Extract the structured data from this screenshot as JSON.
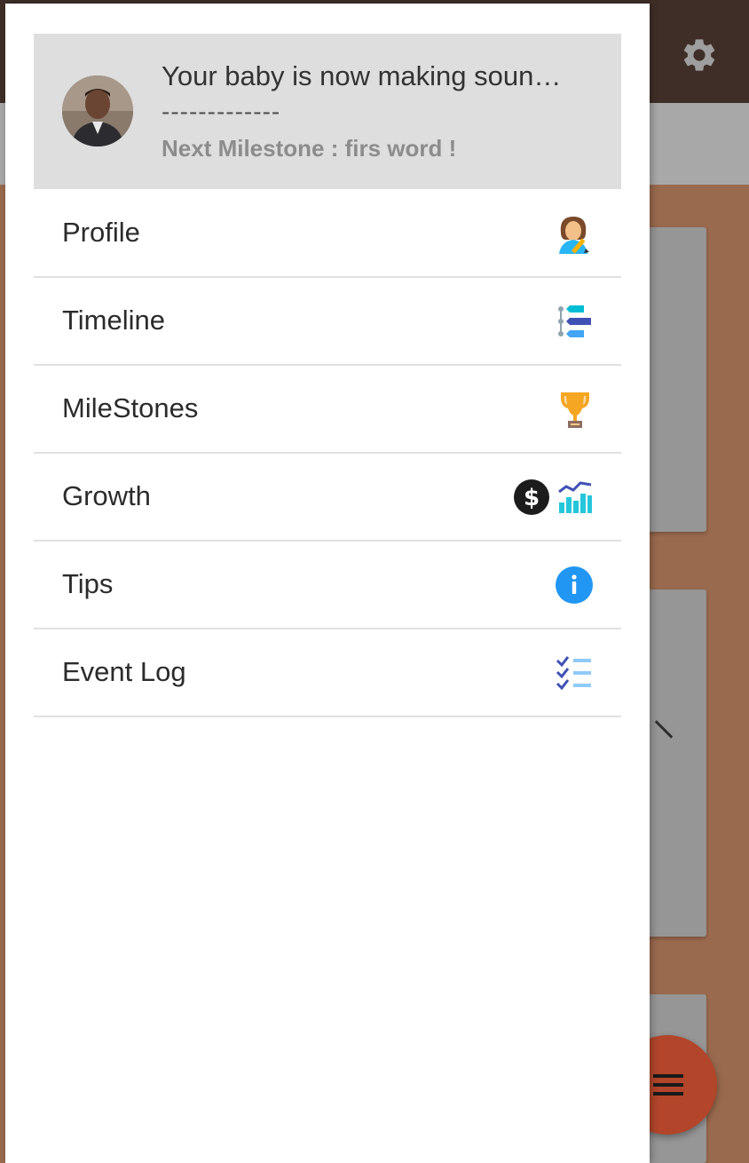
{
  "header": {
    "title": "Your baby is now making soun…",
    "divider": "-------------",
    "next_milestone": "Next Milestone : firs word !"
  },
  "menu": {
    "items": [
      {
        "label": "Profile",
        "icon": "woman-writing-icon"
      },
      {
        "label": "Timeline",
        "icon": "timeline-icon"
      },
      {
        "label": "MileStones",
        "icon": "trophy-icon"
      },
      {
        "label": "Growth",
        "icon": "dollar-chart-icon"
      },
      {
        "label": "Tips",
        "icon": "info-icon"
      },
      {
        "label": "Event Log",
        "icon": "checklist-icon"
      }
    ]
  },
  "colors": {
    "topbar": "#3f2e27",
    "background": "#9a6a4e",
    "header_bg": "#dedede",
    "fab": "#b2452a",
    "info_blue": "#2196f3"
  }
}
